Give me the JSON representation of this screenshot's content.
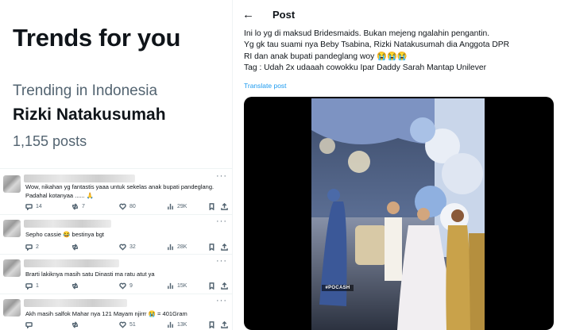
{
  "trends": {
    "title": "Trends for you",
    "context": "Trending in Indonesia",
    "name": "Rizki Natakusumah",
    "posts": "1,155 posts"
  },
  "tweets": [
    {
      "text": "Wow, nikahan yg fantastis yaaa untuk sekelas anak bupati pandeglang.\nPadahal kotanyaa ...... 🙏",
      "replies": "14",
      "reposts": "7",
      "likes": "80",
      "views": "29K"
    },
    {
      "text": "Sepho cassie 😂 bestinya bgt",
      "replies": "2",
      "reposts": "",
      "likes": "32",
      "views": "28K"
    },
    {
      "text": "Brarti lakiknya masih satu Dinasti ma ratu atut ya",
      "replies": "1",
      "reposts": "",
      "likes": "9",
      "views": "15K"
    },
    {
      "text": "Akh masih salfok Mahar nya 121 Mayam njirrr 😭 = 401Gram",
      "replies": "",
      "reposts": "",
      "likes": "51",
      "views": "13K"
    }
  ],
  "post": {
    "back_icon": "←",
    "header": "Post",
    "lines": [
      "Ini lo yg di maksud Bridesmaids. Bukan mejeng ngalahin pengantin.",
      "Yg gk tau suami nya Beby Tsabina,  Rizki Natakusumah dia Anggota DPR",
      "RI dan anak bupati pandeglang woy 😭😭😭",
      "Tag : Udah 2x udaaah cowokku Ipar Daddy Sarah Mantap Unilever"
    ],
    "translate": "Translate post",
    "video_watermark": "#POCASH"
  },
  "colors": {
    "accent": "#1d9bf0",
    "text": "#0f1419",
    "muted": "#536471",
    "divider": "#eff3f4"
  }
}
